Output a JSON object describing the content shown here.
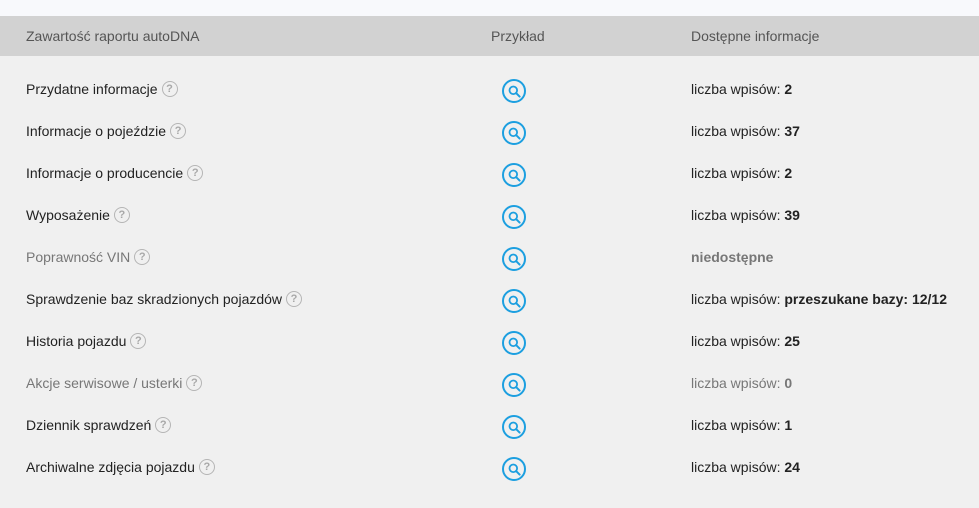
{
  "header": {
    "col_content": "Zawartość raportu autoDNA",
    "col_example": "Przykład",
    "col_info": "Dostępne informacje"
  },
  "rows": [
    {
      "label": "Przydatne informacje",
      "info_prefix": "liczba wpisów:",
      "info_value": "2",
      "muted": false
    },
    {
      "label": "Informacje o pojeździe",
      "info_prefix": "liczba wpisów:",
      "info_value": "37",
      "muted": false
    },
    {
      "label": "Informacje o producencie",
      "info_prefix": "liczba wpisów:",
      "info_value": "2",
      "muted": false
    },
    {
      "label": "Wyposażenie",
      "info_prefix": "liczba wpisów:",
      "info_value": "39",
      "muted": false
    },
    {
      "label": "Poprawność VIN",
      "info_prefix": "",
      "info_value": "niedostępne",
      "muted": true
    },
    {
      "label": "Sprawdzenie baz skradzionych pojazdów",
      "info_prefix": "liczba wpisów:",
      "info_value": "przeszukane bazy: 12/12",
      "muted": false
    },
    {
      "label": "Historia pojazdu",
      "info_prefix": "liczba wpisów:",
      "info_value": "25",
      "muted": false
    },
    {
      "label": "Akcje serwisowe / usterki",
      "info_prefix": "liczba wpisów:",
      "info_value": "0",
      "muted": true
    },
    {
      "label": "Dziennik sprawdzeń",
      "info_prefix": "liczba wpisów:",
      "info_value": "1",
      "muted": false
    },
    {
      "label": "Archiwalne zdjęcia pojazdu",
      "info_prefix": "liczba wpisów:",
      "info_value": "24",
      "muted": false
    }
  ],
  "help_glyph": "?",
  "icons": {
    "help": "question-mark-icon",
    "example": "magnifier-icon"
  },
  "colors": {
    "header_bg": "#d2d2d2",
    "accent": "#1c9fe0",
    "text": "#222222",
    "muted_text": "#777777"
  }
}
